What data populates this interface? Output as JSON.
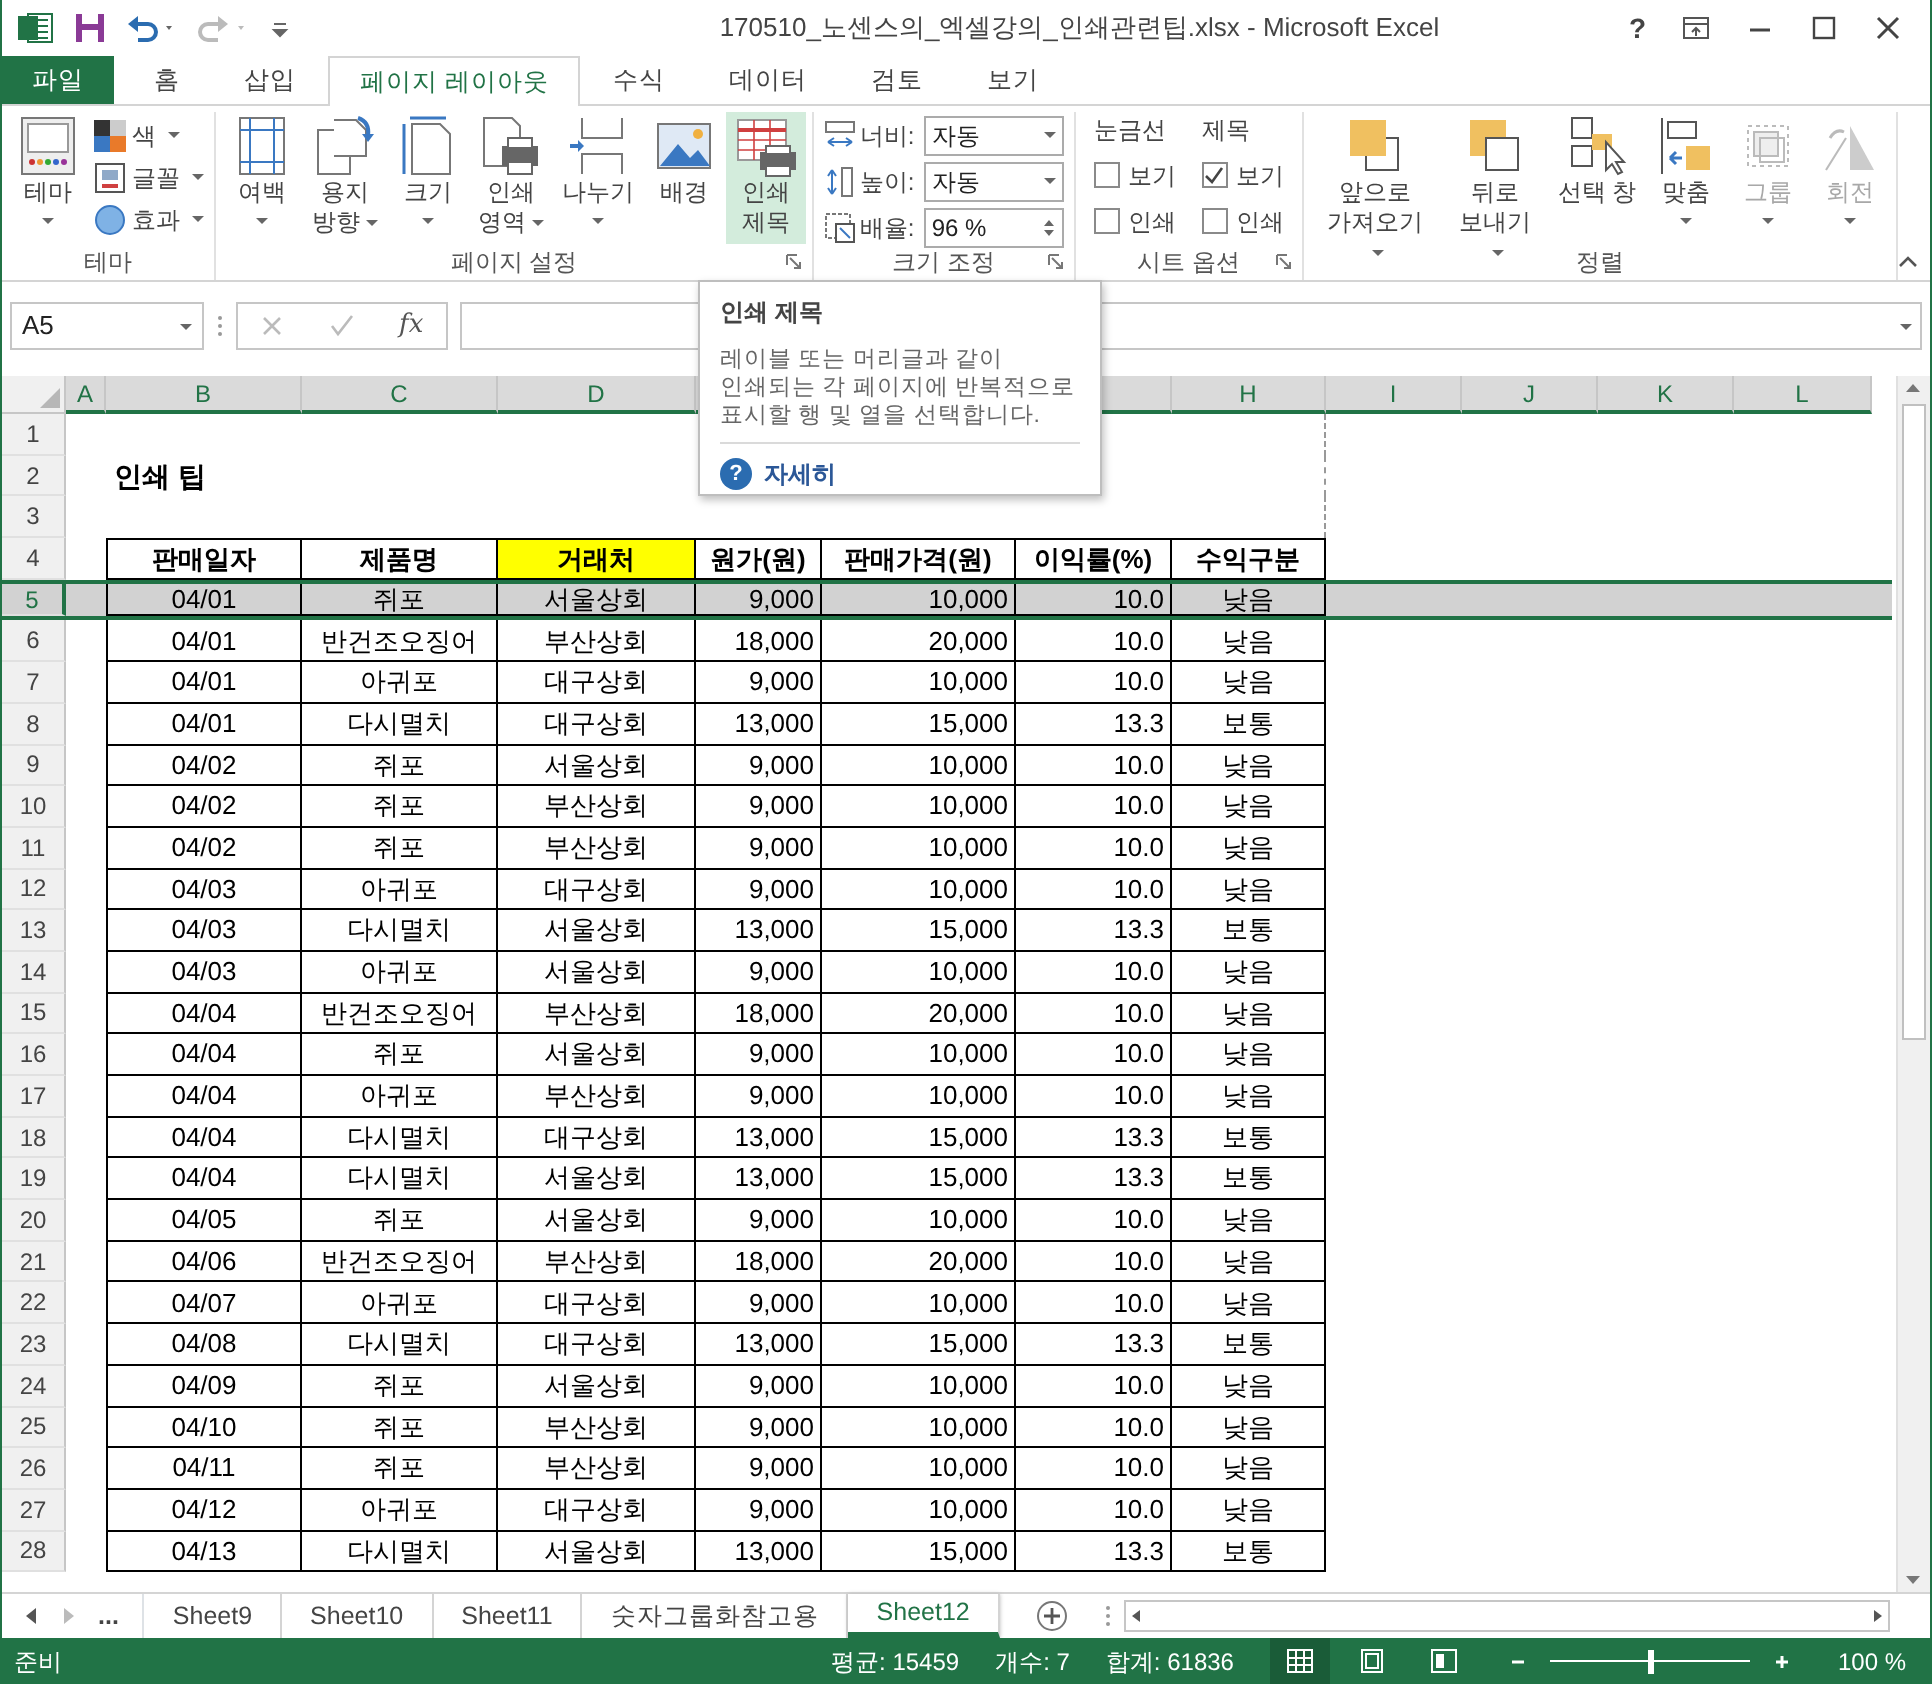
{
  "title_bar": {
    "title": "170510_노센스의_엑셀강의_인쇄관련팁.xlsx - Microsoft Excel",
    "help": "?"
  },
  "tabs": [
    {
      "label": "파일",
      "kind": "file",
      "selected": false
    },
    {
      "label": "홈",
      "kind": "tab",
      "selected": false
    },
    {
      "label": "삽입",
      "kind": "tab",
      "selected": false
    },
    {
      "label": "페이지 레이아웃",
      "kind": "tab",
      "selected": true
    },
    {
      "label": "수식",
      "kind": "tab",
      "selected": false
    },
    {
      "label": "데이터",
      "kind": "tab",
      "selected": false
    },
    {
      "label": "검토",
      "kind": "tab",
      "selected": false
    },
    {
      "label": "보기",
      "kind": "tab",
      "selected": false
    }
  ],
  "ribbon": {
    "groups": [
      {
        "label": "테마",
        "launcher": false,
        "items": [
          {
            "kind": "large",
            "lines": [
              "테마"
            ],
            "dropdown": true,
            "hovered": false,
            "disabled": false
          },
          {
            "kind": "stack",
            "buttons": [
              {
                "label": "색",
                "dropdown": true
              },
              {
                "label": "글꼴",
                "dropdown": true
              },
              {
                "label": "효과",
                "dropdown": true
              }
            ]
          }
        ]
      },
      {
        "label": "페이지 설정",
        "launcher": true,
        "items": [
          {
            "kind": "large",
            "lines": [
              "여백"
            ],
            "dropdown": true,
            "hovered": false,
            "disabled": false
          },
          {
            "kind": "large",
            "lines": [
              "용지",
              "방향"
            ],
            "dropdown": true,
            "hovered": false,
            "disabled": false
          },
          {
            "kind": "large",
            "lines": [
              "크기"
            ],
            "dropdown": true,
            "hovered": false,
            "disabled": false
          },
          {
            "kind": "large",
            "lines": [
              "인쇄",
              "영역"
            ],
            "dropdown": true,
            "hovered": false,
            "disabled": false
          },
          {
            "kind": "large",
            "lines": [
              "나누기"
            ],
            "dropdown": true,
            "hovered": false,
            "disabled": false
          },
          {
            "kind": "large",
            "lines": [
              "배경"
            ],
            "dropdown": false,
            "hovered": false,
            "disabled": false
          },
          {
            "kind": "large",
            "lines": [
              "인쇄",
              "제목"
            ],
            "dropdown": false,
            "hovered": true,
            "disabled": false
          }
        ]
      },
      {
        "label": "크기 조정",
        "launcher": true,
        "items": [
          {
            "kind": "fields",
            "fields": [
              {
                "kind": "select",
                "label": "너비:",
                "value": "자동"
              },
              {
                "kind": "select",
                "label": "높이:",
                "value": "자동"
              },
              {
                "kind": "spin",
                "label": "배율:",
                "value": "96 %"
              }
            ]
          }
        ]
      },
      {
        "label": "시트 옵션",
        "launcher": true,
        "items": [
          {
            "kind": "checks",
            "heading": "눈금선",
            "checks": [
              {
                "label": "보기",
                "checked": false
              },
              {
                "label": "인쇄",
                "checked": false
              }
            ]
          },
          {
            "kind": "checks",
            "heading": "제목",
            "checks": [
              {
                "label": "보기",
                "checked": true
              },
              {
                "label": "인쇄",
                "checked": false
              }
            ]
          }
        ]
      },
      {
        "label": "정렬",
        "launcher": false,
        "items": [
          {
            "kind": "large",
            "lines": [
              "앞으로",
              "가져오기"
            ],
            "dropdown": true,
            "hovered": false,
            "disabled": false
          },
          {
            "kind": "large",
            "lines": [
              "뒤로",
              "보내기"
            ],
            "dropdown": true,
            "hovered": false,
            "disabled": false
          },
          {
            "kind": "large",
            "lines": [
              "선택 창"
            ],
            "dropdown": false,
            "hovered": false,
            "disabled": false
          },
          {
            "kind": "large",
            "lines": [
              "맞춤"
            ],
            "dropdown": true,
            "hovered": false,
            "disabled": false
          },
          {
            "kind": "large",
            "lines": [
              "그룹"
            ],
            "dropdown": true,
            "hovered": false,
            "disabled": true
          },
          {
            "kind": "large",
            "lines": [
              "회전"
            ],
            "dropdown": true,
            "hovered": false,
            "disabled": true
          }
        ]
      }
    ]
  },
  "formula_bar": {
    "name_box": "A5",
    "function_label": "fx"
  },
  "tooltip": {
    "title": "인쇄 제목",
    "text": "레이블 또는 머리글과 같이\n인쇄되는 각 페이지에 반복적으로\n표시할 행 및 열을 선택합니다.",
    "link_icon": "?",
    "link": "자세히"
  },
  "sheet": {
    "column_headers": [
      "A",
      "B",
      "C",
      "D",
      "H",
      "I",
      "J",
      "K",
      "L"
    ],
    "row_headers": [
      {
        "label": "1",
        "selected": false
      },
      {
        "label": "2",
        "selected": false
      },
      {
        "label": "3",
        "selected": false
      },
      {
        "label": "4",
        "selected": false
      },
      {
        "label": "5",
        "selected": true
      },
      {
        "label": "6",
        "selected": false
      },
      {
        "label": "7",
        "selected": false
      },
      {
        "label": "8",
        "selected": false
      },
      {
        "label": "9",
        "selected": false
      },
      {
        "label": "10",
        "selected": false
      },
      {
        "label": "11",
        "selected": false
      },
      {
        "label": "12",
        "selected": false
      },
      {
        "label": "13",
        "selected": false
      },
      {
        "label": "14",
        "selected": false
      },
      {
        "label": "15",
        "selected": false
      },
      {
        "label": "16",
        "selected": false
      },
      {
        "label": "17",
        "selected": false
      },
      {
        "label": "18",
        "selected": false
      },
      {
        "label": "19",
        "selected": false
      },
      {
        "label": "20",
        "selected": false
      },
      {
        "label": "21",
        "selected": false
      },
      {
        "label": "22",
        "selected": false
      },
      {
        "label": "23",
        "selected": false
      },
      {
        "label": "24",
        "selected": false
      },
      {
        "label": "25",
        "selected": false
      },
      {
        "label": "26",
        "selected": false
      },
      {
        "label": "27",
        "selected": false
      },
      {
        "label": "28",
        "selected": false
      }
    ],
    "title": "인쇄 팁",
    "table": {
      "columns": [
        {
          "label": "판매일자",
          "color": "#ffffff"
        },
        {
          "label": "제품명",
          "color": "#ffffff"
        },
        {
          "label": "거래처",
          "color": "#ffff00"
        },
        {
          "label": "원가(원)",
          "color": "#ffffff"
        },
        {
          "label": "판매가격(원)",
          "color": "#ffffff"
        },
        {
          "label": "이익률(%)",
          "color": "#ffffff"
        },
        {
          "label": "수익구분",
          "color": "#ffffff"
        }
      ],
      "rows": [
        [
          "04/01",
          "쥐포",
          "서울상회",
          "9,000",
          "10,000",
          "10.0",
          "낮음"
        ],
        [
          "04/01",
          "반건조오징어",
          "부산상회",
          "18,000",
          "20,000",
          "10.0",
          "낮음"
        ],
        [
          "04/01",
          "아귀포",
          "대구상회",
          "9,000",
          "10,000",
          "10.0",
          "낮음"
        ],
        [
          "04/01",
          "다시멸치",
          "대구상회",
          "13,000",
          "15,000",
          "13.3",
          "보통"
        ],
        [
          "04/02",
          "쥐포",
          "서울상회",
          "9,000",
          "10,000",
          "10.0",
          "낮음"
        ],
        [
          "04/02",
          "쥐포",
          "부산상회",
          "9,000",
          "10,000",
          "10.0",
          "낮음"
        ],
        [
          "04/02",
          "쥐포",
          "부산상회",
          "9,000",
          "10,000",
          "10.0",
          "낮음"
        ],
        [
          "04/03",
          "아귀포",
          "대구상회",
          "9,000",
          "10,000",
          "10.0",
          "낮음"
        ],
        [
          "04/03",
          "다시멸치",
          "서울상회",
          "13,000",
          "15,000",
          "13.3",
          "보통"
        ],
        [
          "04/03",
          "아귀포",
          "서울상회",
          "9,000",
          "10,000",
          "10.0",
          "낮음"
        ],
        [
          "04/04",
          "반건조오징어",
          "부산상회",
          "18,000",
          "20,000",
          "10.0",
          "낮음"
        ],
        [
          "04/04",
          "쥐포",
          "서울상회",
          "9,000",
          "10,000",
          "10.0",
          "낮음"
        ],
        [
          "04/04",
          "아귀포",
          "부산상회",
          "9,000",
          "10,000",
          "10.0",
          "낮음"
        ],
        [
          "04/04",
          "다시멸치",
          "대구상회",
          "13,000",
          "15,000",
          "13.3",
          "보통"
        ],
        [
          "04/04",
          "다시멸치",
          "서울상회",
          "13,000",
          "15,000",
          "13.3",
          "보통"
        ],
        [
          "04/05",
          "쥐포",
          "서울상회",
          "9,000",
          "10,000",
          "10.0",
          "낮음"
        ],
        [
          "04/06",
          "반건조오징어",
          "부산상회",
          "18,000",
          "20,000",
          "10.0",
          "낮음"
        ],
        [
          "04/07",
          "아귀포",
          "대구상회",
          "9,000",
          "10,000",
          "10.0",
          "낮음"
        ],
        [
          "04/08",
          "다시멸치",
          "대구상회",
          "13,000",
          "15,000",
          "13.3",
          "보통"
        ],
        [
          "04/09",
          "쥐포",
          "서울상회",
          "9,000",
          "10,000",
          "10.0",
          "낮음"
        ],
        [
          "04/10",
          "쥐포",
          "부산상회",
          "9,000",
          "10,000",
          "10.0",
          "낮음"
        ],
        [
          "04/11",
          "쥐포",
          "부산상회",
          "9,000",
          "10,000",
          "10.0",
          "낮음"
        ],
        [
          "04/12",
          "아귀포",
          "대구상회",
          "9,000",
          "10,000",
          "10.0",
          "낮음"
        ],
        [
          "04/13",
          "다시멸치",
          "서울상회",
          "13,000",
          "15,000",
          "13.3",
          "보통"
        ]
      ]
    }
  },
  "sheet_tabs": {
    "more": "...",
    "tabs": [
      {
        "label": "Sheet9",
        "selected": false
      },
      {
        "label": "Sheet10",
        "selected": false
      },
      {
        "label": "Sheet11",
        "selected": false
      },
      {
        "label": "숫자그룹화참고용",
        "selected": false
      },
      {
        "label": "Sheet12",
        "selected": true
      }
    ]
  },
  "status_bar": {
    "mode": "준비",
    "stats": [
      "평균: 15459",
      "개수: 7",
      "합계: 61836"
    ],
    "views": [
      {
        "selected": true
      },
      {
        "selected": false
      },
      {
        "selected": false
      }
    ],
    "zoom": {
      "level": 0.5,
      "reading": "100 %"
    }
  }
}
